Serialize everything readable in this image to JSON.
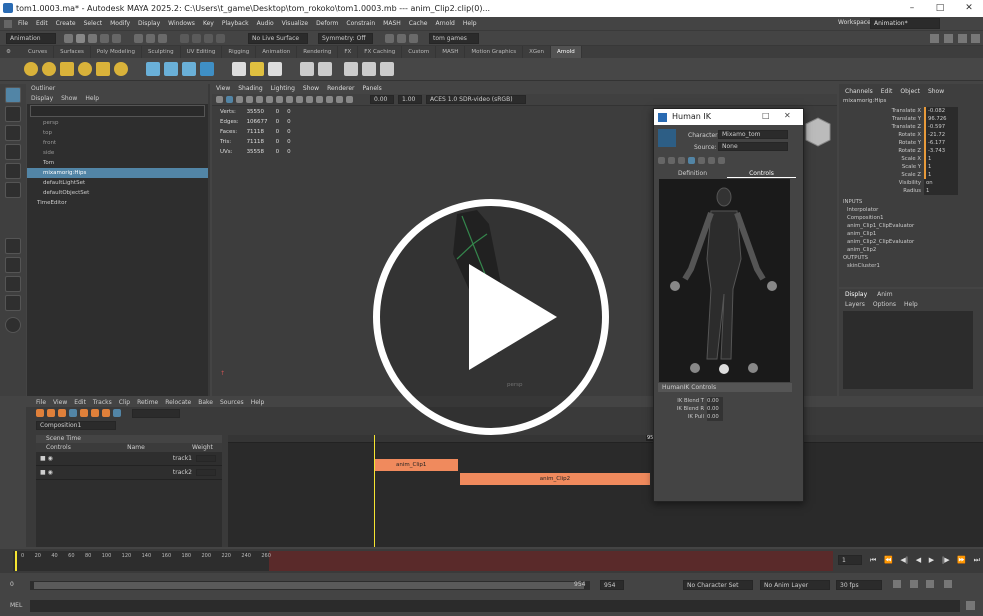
{
  "window": {
    "title": "tom1.0003.ma* - Autodesk MAYA 2025.2: C:\\Users\\t_game\\Desktop\\tom_rokoko\\tom1.0003.mb  ---  anim_Clip2.clip(0)..."
  },
  "menu": [
    "File",
    "Edit",
    "Create",
    "Select",
    "Modify",
    "Display",
    "Windows",
    "Key",
    "Playback",
    "Audio",
    "Visualize",
    "Deform",
    "Constrain",
    "MASH",
    "Cache",
    "Arnold",
    "Help"
  ],
  "workspace": {
    "label": "Workspace :",
    "value": "Animation*"
  },
  "statusline": {
    "mode": "Animation",
    "live_surface": "No Live Surface",
    "symmetry": "Symmetry: Off",
    "user": "tom games"
  },
  "shelf_tabs": [
    "Curves",
    "Surfaces",
    "Poly Modeling",
    "Sculpting",
    "UV Editing",
    "Rigging",
    "Animation",
    "Rendering",
    "FX",
    "FX Caching",
    "Custom",
    "MASH",
    "Motion Graphics",
    "XGen",
    "Arnold"
  ],
  "shelf_active": "Arnold",
  "outliner": {
    "title": "Outliner",
    "menu": [
      "Display",
      "Show",
      "Help"
    ],
    "items": [
      "persp",
      "top",
      "front",
      "side",
      "Tom",
      "mixamorig:Hips",
      "defaultLightSet",
      "defaultObjectSet",
      "TimeEditor"
    ],
    "selected": "mixamorig:Hips"
  },
  "viewport": {
    "menu": [
      "View",
      "Shading",
      "Lighting",
      "Show",
      "Renderer",
      "Panels"
    ],
    "field1": "0.00",
    "field2": "1.00",
    "colorspace": "ACES 1.0 SDR-video (sRGB)",
    "camera_label": "persp",
    "hud": [
      {
        "label": "Verts:",
        "a": "35550",
        "b": "0",
        "c": "0"
      },
      {
        "label": "Edges:",
        "a": "106677",
        "b": "0",
        "c": "0"
      },
      {
        "label": "Faces:",
        "a": "71118",
        "b": "0",
        "c": "0"
      },
      {
        "label": "Tris:",
        "a": "71118",
        "b": "0",
        "c": "0"
      },
      {
        "label": "UVs:",
        "a": "35558",
        "b": "0",
        "c": "0"
      }
    ]
  },
  "human_ik": {
    "title": "Human IK",
    "character_label": "Character:",
    "character_value": "Mixamo_tom",
    "source_label": "Source:",
    "source_value": "None",
    "tabs": [
      "Definition",
      "Controls"
    ],
    "active_tab": "Controls",
    "section": "HumanIK Controls",
    "sliders": [
      {
        "label": "IK Blend T",
        "value": "0.00"
      },
      {
        "label": "IK Blend R",
        "value": "0.00"
      },
      {
        "label": "IK Pull",
        "value": "0.00"
      }
    ]
  },
  "channel_box": {
    "menu": [
      "Channels",
      "Edit",
      "Object",
      "Show"
    ],
    "object": "mixamorig:Hips",
    "attrs": [
      {
        "label": "Translate X",
        "value": "-0.082"
      },
      {
        "label": "Translate Y",
        "value": "96.726"
      },
      {
        "label": "Translate Z",
        "value": "-0.597"
      },
      {
        "label": "Rotate X",
        "value": "-21.72"
      },
      {
        "label": "Rotate Y",
        "value": "-6.177"
      },
      {
        "label": "Rotate Z",
        "value": "-3.743"
      },
      {
        "label": "Scale X",
        "value": "1"
      },
      {
        "label": "Scale Y",
        "value": "1"
      },
      {
        "label": "Scale Z",
        "value": "1"
      },
      {
        "label": "Visibility",
        "value": "on"
      },
      {
        "label": "Radius",
        "value": "1"
      }
    ],
    "inputs_label": "INPUTS",
    "inputs": [
      "Interpolator",
      "Composition1",
      "anim_Clip1_ClipEvaluator",
      "anim_Clip1",
      "anim_Clip2_ClipEvaluator",
      "anim_Clip2"
    ],
    "outputs_label": "OUTPUTS",
    "outputs": [
      "skinCluster1"
    ]
  },
  "layer_editor": {
    "tabs": [
      "Display",
      "Anim"
    ],
    "menu": [
      "Layers",
      "Options",
      "Help"
    ]
  },
  "time_editor": {
    "menu": [
      "File",
      "View",
      "Edit",
      "Tracks",
      "Clip",
      "Retime",
      "Relocate",
      "Bake",
      "Sources",
      "Help"
    ],
    "composition": "Composition1",
    "scene_time": "Scene Time",
    "columns": [
      "Controls",
      "Name",
      "Weight"
    ],
    "tracks": [
      {
        "name": "track1"
      },
      {
        "name": "track2"
      }
    ],
    "clips": [
      {
        "label": "anim_Clip1"
      },
      {
        "label": "anim_Clip2"
      }
    ],
    "marker_end": "954"
  },
  "timeline": {
    "ticks": [
      "0",
      "20",
      "40",
      "60",
      "80",
      "100",
      "120",
      "140",
      "160",
      "180",
      "200",
      "220",
      "240",
      "260"
    ],
    "current": "1"
  },
  "range": {
    "start": "0",
    "end": "954",
    "end2": "954",
    "character_set": "No Character Set",
    "anim_layer": "No Anim Layer",
    "fps": "30 fps"
  },
  "cmdline": {
    "label": "MEL"
  },
  "colors": {
    "accent": "#5285a6",
    "clip": "#f08a5d",
    "playhead": "#f5e431"
  }
}
